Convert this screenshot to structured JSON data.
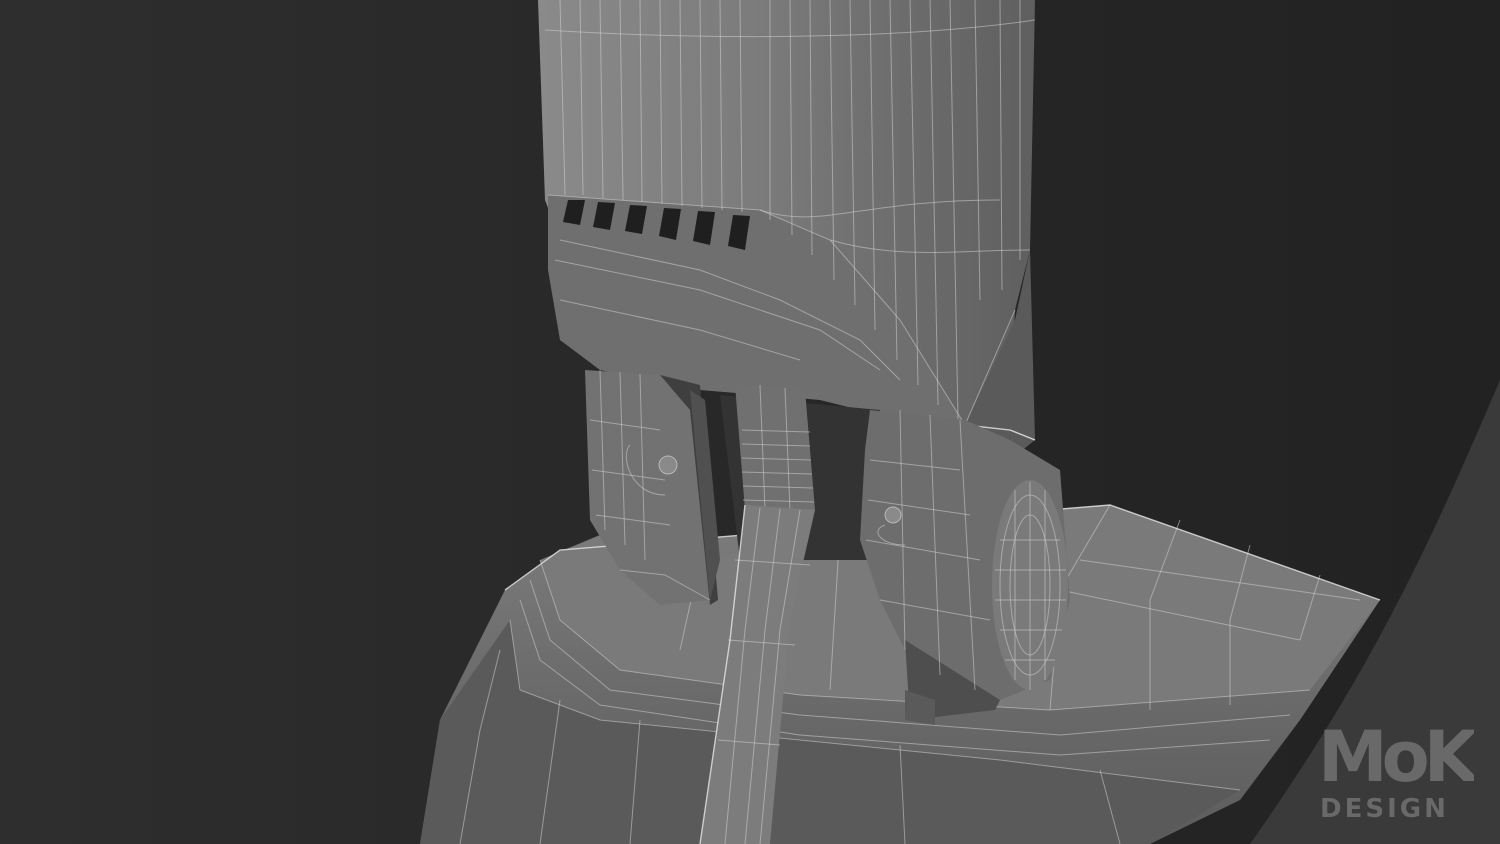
{
  "scene": {
    "description_subject": "wireframe-render",
    "colors": {
      "background": "#262626",
      "backdrop_curve": "#3a3a3a",
      "mesh_base": "#6e6e6e",
      "mesh_light": "#8c8c8c",
      "mesh_dark": "#4a4a4a",
      "wire": "#d0d0d0"
    }
  },
  "watermark": {
    "logo_text": "MoK",
    "sub_text": "DESIGN"
  }
}
